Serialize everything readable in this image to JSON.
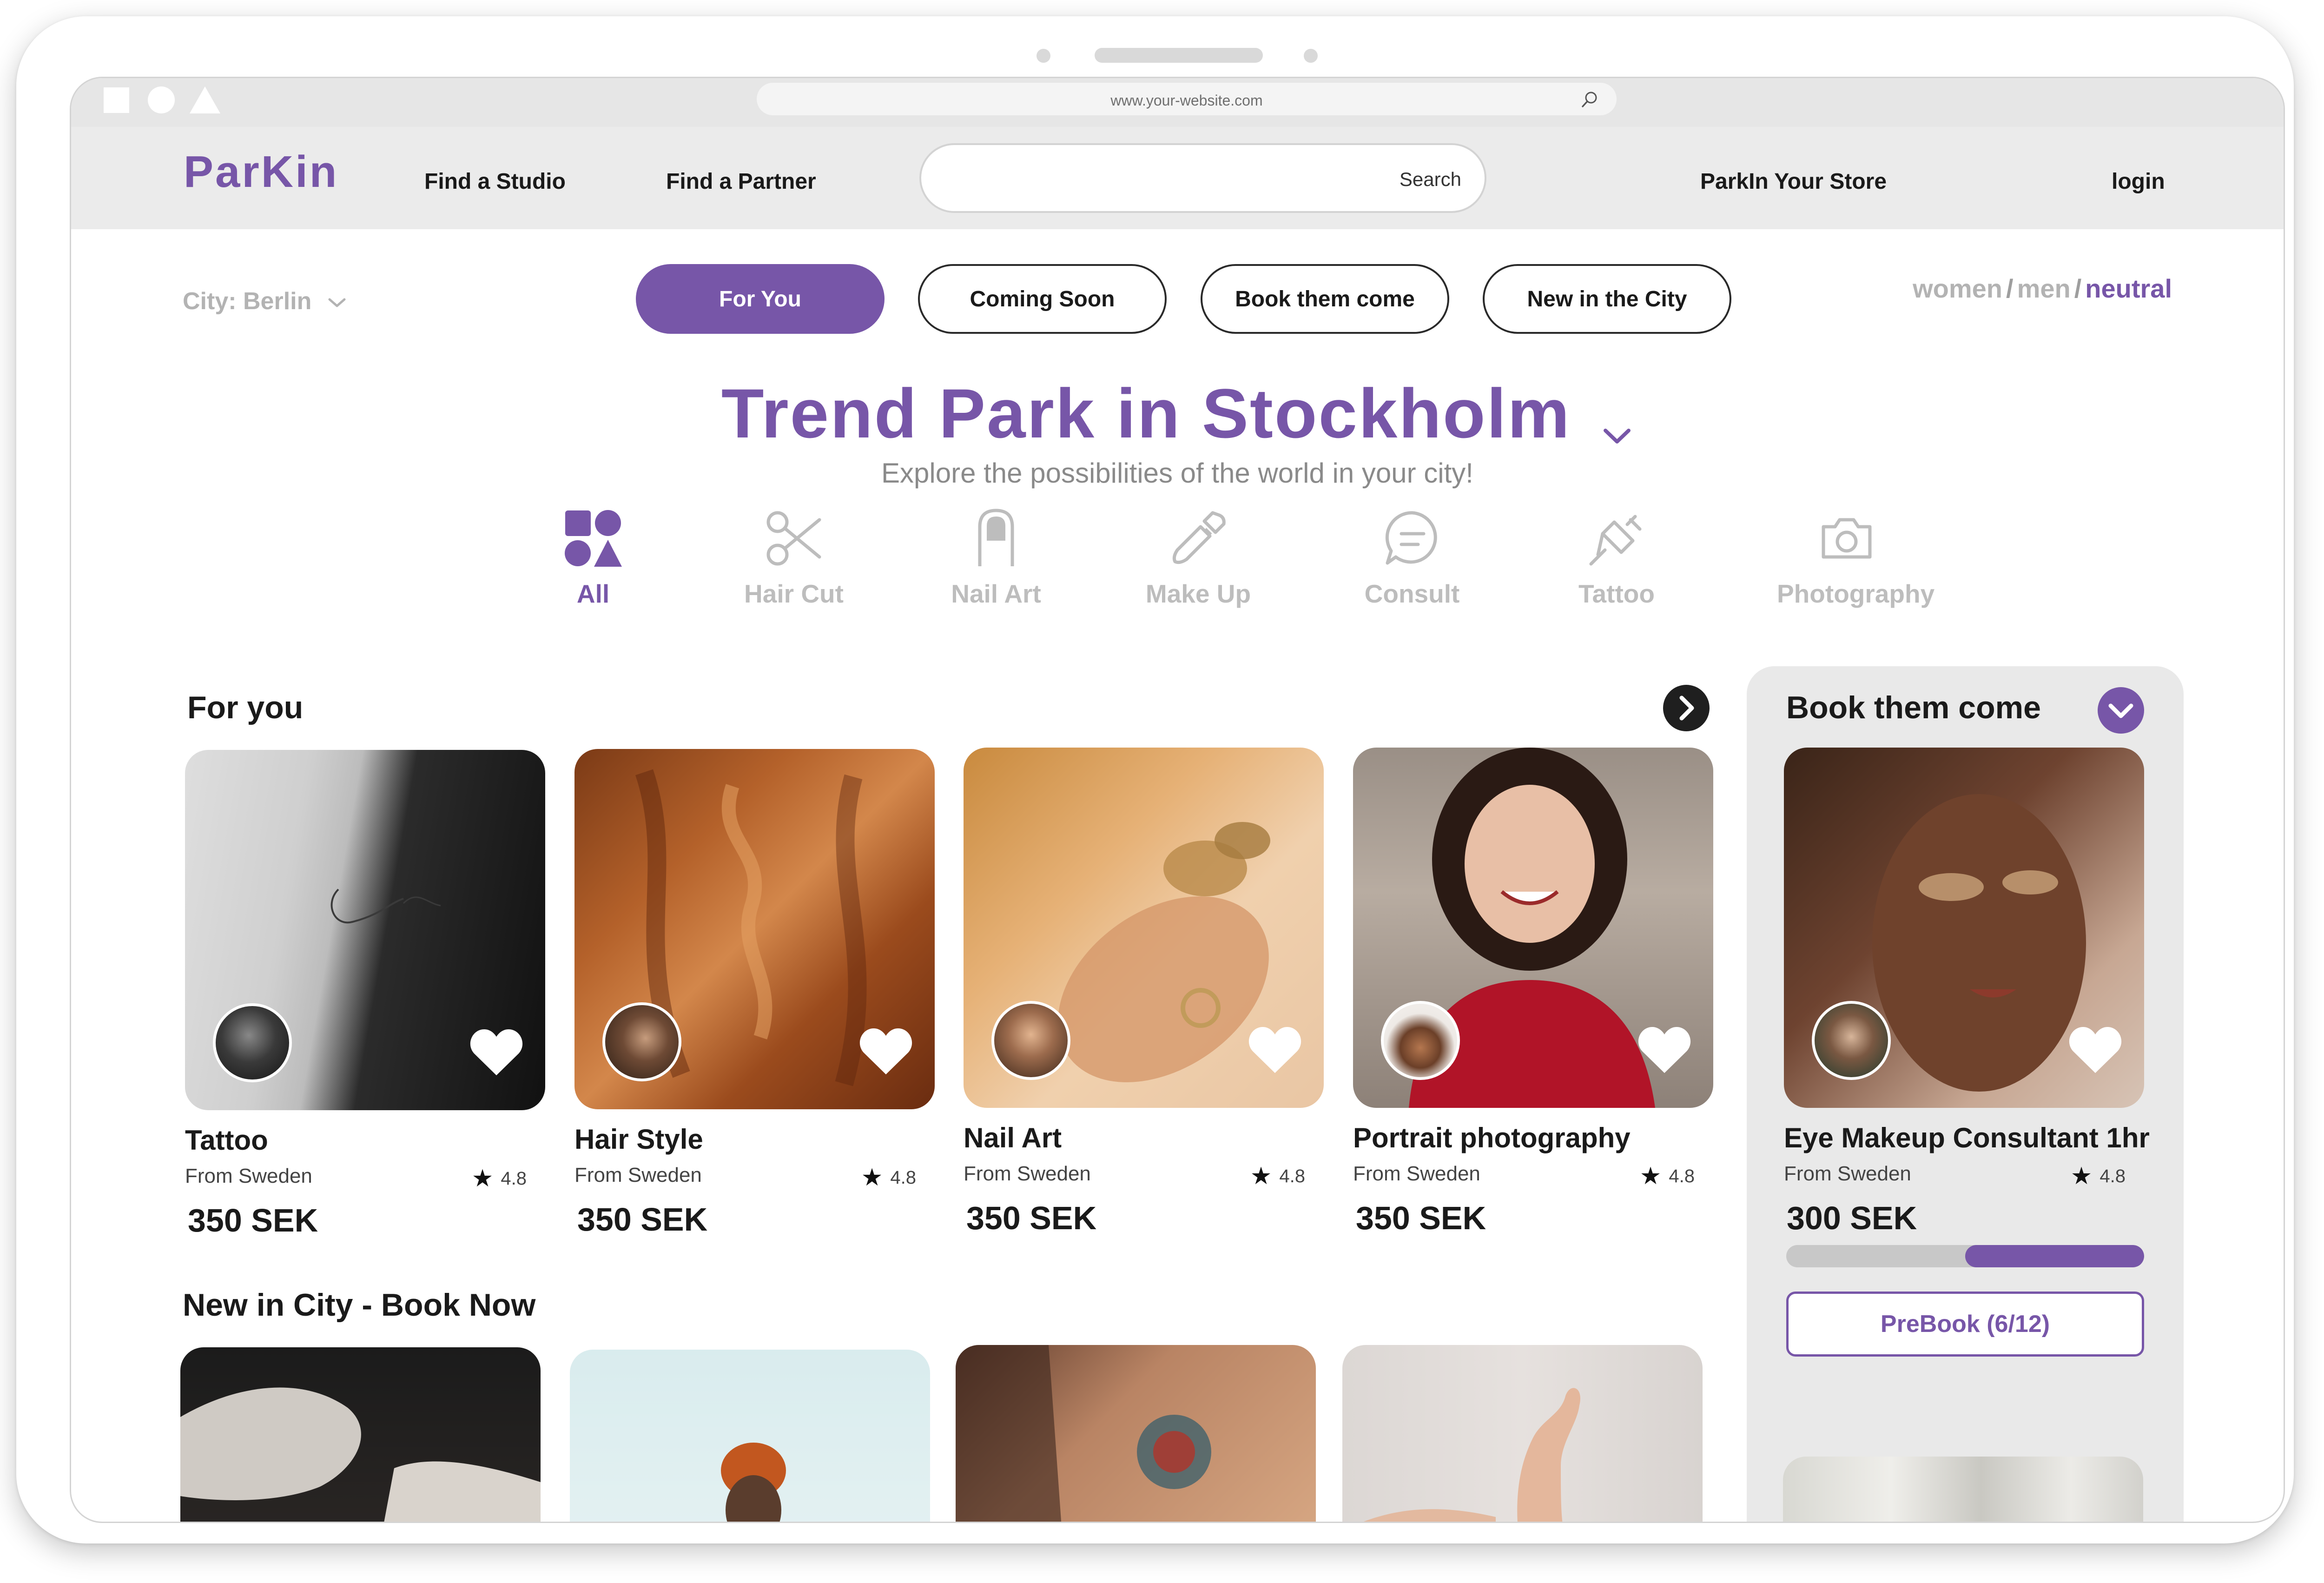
{
  "browser": {
    "url": "www.your-website.com"
  },
  "nav": {
    "logo": "ParKin",
    "links": [
      "Find a Studio",
      "Find a Partner"
    ],
    "search_label": "Search",
    "store_link": "ParkIn Your Store",
    "login": "login"
  },
  "filters": {
    "city": "City: Berlin",
    "pills": [
      "For You",
      "Coming Soon",
      "Book them come",
      "New in the City"
    ],
    "active_pill": "For You",
    "gender": [
      "women",
      "men",
      "neutral"
    ],
    "gender_selected": "neutral",
    "separator": "/"
  },
  "hero": {
    "title": "Trend Park in Stockholm",
    "subtitle": "Explore the possibilities of the world in your city!"
  },
  "categories": [
    {
      "label": "All",
      "icon": "shapes-icon"
    },
    {
      "label": "Hair Cut",
      "icon": "scissors-icon"
    },
    {
      "label": "Nail Art",
      "icon": "nail-icon"
    },
    {
      "label": "Make Up",
      "icon": "makeup-brush-icon"
    },
    {
      "label": "Consult",
      "icon": "chat-bubble-icon"
    },
    {
      "label": "Tattoo",
      "icon": "tattoo-machine-icon"
    },
    {
      "label": "Photography",
      "icon": "camera-icon"
    }
  ],
  "for_you": {
    "title": "For you",
    "cards": [
      {
        "title": "Tattoo",
        "origin": "From Sweden",
        "rating": "4.8",
        "price": "350 SEK"
      },
      {
        "title": "Hair Style",
        "origin": "From Sweden",
        "rating": "4.8",
        "price": "350 SEK"
      },
      {
        "title": "Nail Art",
        "origin": "From Sweden",
        "rating": "4.8",
        "price": "350 SEK"
      },
      {
        "title": "Portrait photography",
        "origin": "From Sweden",
        "rating": "4.8",
        "price": "350 SEK"
      }
    ]
  },
  "book_them_come": {
    "title": "Book them come",
    "card": {
      "title": "Eye Makeup Consultant 1hr",
      "origin": "From Sweden",
      "rating": "4.8",
      "price": "300 SEK"
    },
    "prebook_progress": 0.5,
    "prebook_label": "PreBook (6/12)"
  },
  "new_in_city": {
    "title": "New in City - Book Now"
  },
  "colors": {
    "accent": "#7756a8",
    "muted": "#b3b3b3",
    "panel": "#e9e9e9"
  }
}
